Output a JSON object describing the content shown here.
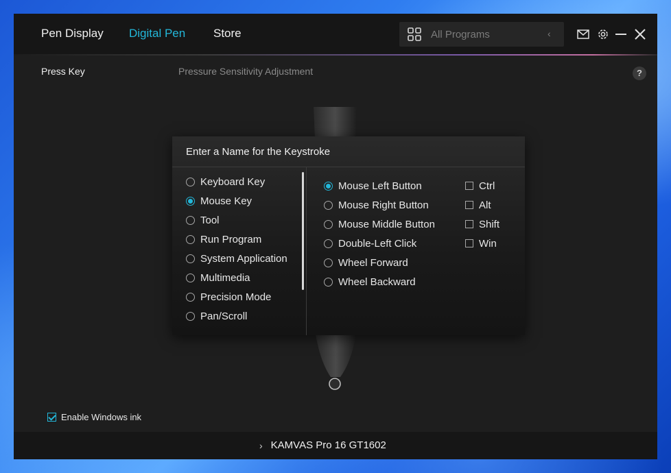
{
  "nav": {
    "tabs": [
      {
        "label": "Pen Display",
        "active": false
      },
      {
        "label": "Digital Pen",
        "active": true
      },
      {
        "label": "Store",
        "active": false
      }
    ]
  },
  "program_select": {
    "label": "All Programs",
    "icon": "grid-icon"
  },
  "window_controls": [
    "mail-icon",
    "gear-icon",
    "minimize-icon",
    "close-icon"
  ],
  "subtabs": {
    "press_key": "Press Key",
    "pressure": "Pressure Sensitivity Adjustment"
  },
  "help": "?",
  "dialog": {
    "title": "Enter a Name for the Keystroke",
    "categories": [
      {
        "label": "Keyboard Key",
        "selected": false
      },
      {
        "label": "Mouse Key",
        "selected": true
      },
      {
        "label": "Tool",
        "selected": false
      },
      {
        "label": "Run Program",
        "selected": false
      },
      {
        "label": "System Application",
        "selected": false
      },
      {
        "label": "Multimedia",
        "selected": false
      },
      {
        "label": "Precision Mode",
        "selected": false
      },
      {
        "label": "Pan/Scroll",
        "selected": false
      }
    ],
    "mouse_buttons": [
      {
        "label": "Mouse Left Button",
        "selected": true
      },
      {
        "label": "Mouse Right Button",
        "selected": false
      },
      {
        "label": "Mouse Middle Button",
        "selected": false
      },
      {
        "label": "Double-Left Click",
        "selected": false
      },
      {
        "label": "Wheel Forward",
        "selected": false
      },
      {
        "label": "Wheel Backward",
        "selected": false
      }
    ],
    "modifiers": [
      {
        "label": "Ctrl",
        "checked": false
      },
      {
        "label": "Alt",
        "checked": false
      },
      {
        "label": "Shift",
        "checked": false
      },
      {
        "label": "Win",
        "checked": false
      }
    ]
  },
  "windows_ink": {
    "label": "Enable Windows ink",
    "checked": true
  },
  "footer": {
    "device": "KAMVAS Pro 16 GT1602"
  },
  "colors": {
    "accent": "#23b7d9",
    "window_bg": "#1e1e1e",
    "titlebar_bg": "#161616"
  }
}
